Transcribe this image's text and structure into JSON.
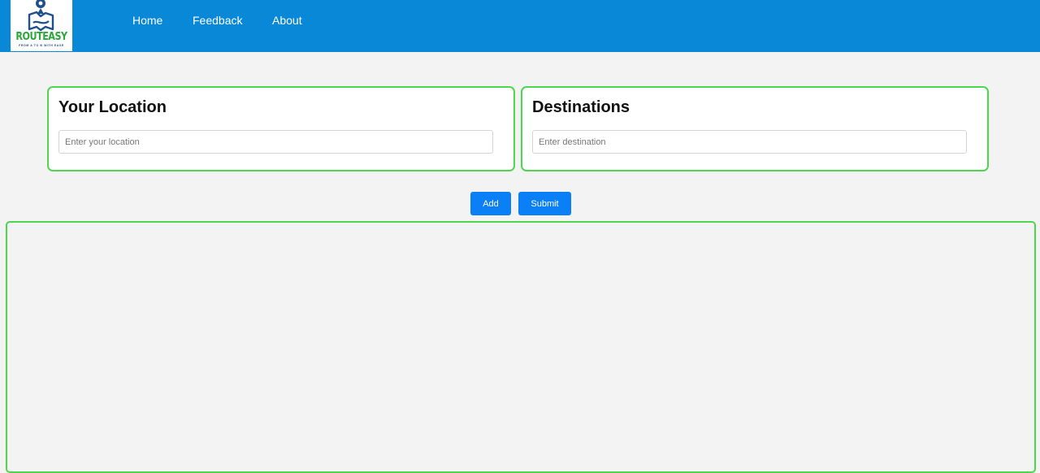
{
  "brand": {
    "name": "ROUTEASY",
    "tagline": "FROM A TO B WITH EASE"
  },
  "nav": {
    "home": "Home",
    "feedback": "Feedback",
    "about": "About"
  },
  "location_card": {
    "title": "Your Location",
    "placeholder": "Enter your location",
    "value": ""
  },
  "destination_card": {
    "title": "Destinations",
    "placeholder": "Enter destination",
    "value": ""
  },
  "actions": {
    "add_label": "Add",
    "submit_label": "Submit"
  },
  "colors": {
    "navbar": "#0a88d8",
    "accent_border": "#4fd64f",
    "button": "#0b7ff5",
    "logo_text": "#2aa63a",
    "background": "#f3f3f3"
  }
}
